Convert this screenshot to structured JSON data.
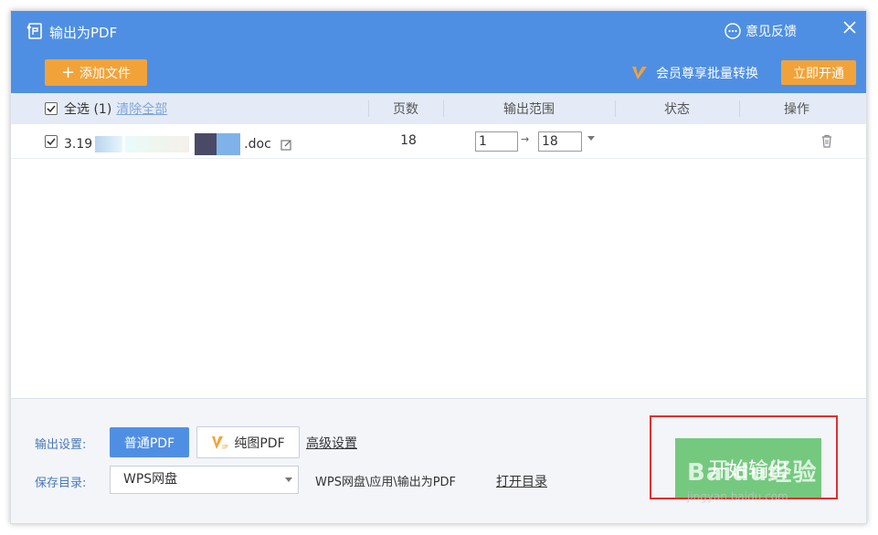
{
  "window": {
    "title": "输出为PDF",
    "feedback_label": "意见反馈"
  },
  "toolbar": {
    "add_file_label": "添加文件",
    "vip_text": "会员尊享批量转换",
    "open_now_label": "立即开通"
  },
  "table": {
    "select_all": "全选 (1)",
    "clear_all": "清除全部",
    "columns": [
      "页数",
      "输出范围",
      "状态",
      "操作"
    ],
    "rows": [
      {
        "name_prefix": "3.19",
        "name_suffix": ".doc",
        "pages": "18",
        "range_from": "1",
        "range_to": "18",
        "checked": true
      }
    ]
  },
  "bottom": {
    "output_settings_label": "输出设置:",
    "normal_pdf": "普通PDF",
    "pure_image_pdf": "纯图PDF",
    "advanced": "高级设置",
    "save_dir_label": "保存目录:",
    "save_dir_value": "WPS网盘",
    "path": "WPS网盘\\应用\\输出为PDF",
    "open_dir": "打开目录",
    "start_label": "开始输出"
  },
  "watermark": {
    "text": "Baidu经验",
    "sub": "jingyan.baidu.com"
  },
  "colors": {
    "titlebar": "#4f8fe3",
    "accent_orange": "#f1a33a",
    "start_green": "#74c97f",
    "highlight_red": "#e03030"
  }
}
